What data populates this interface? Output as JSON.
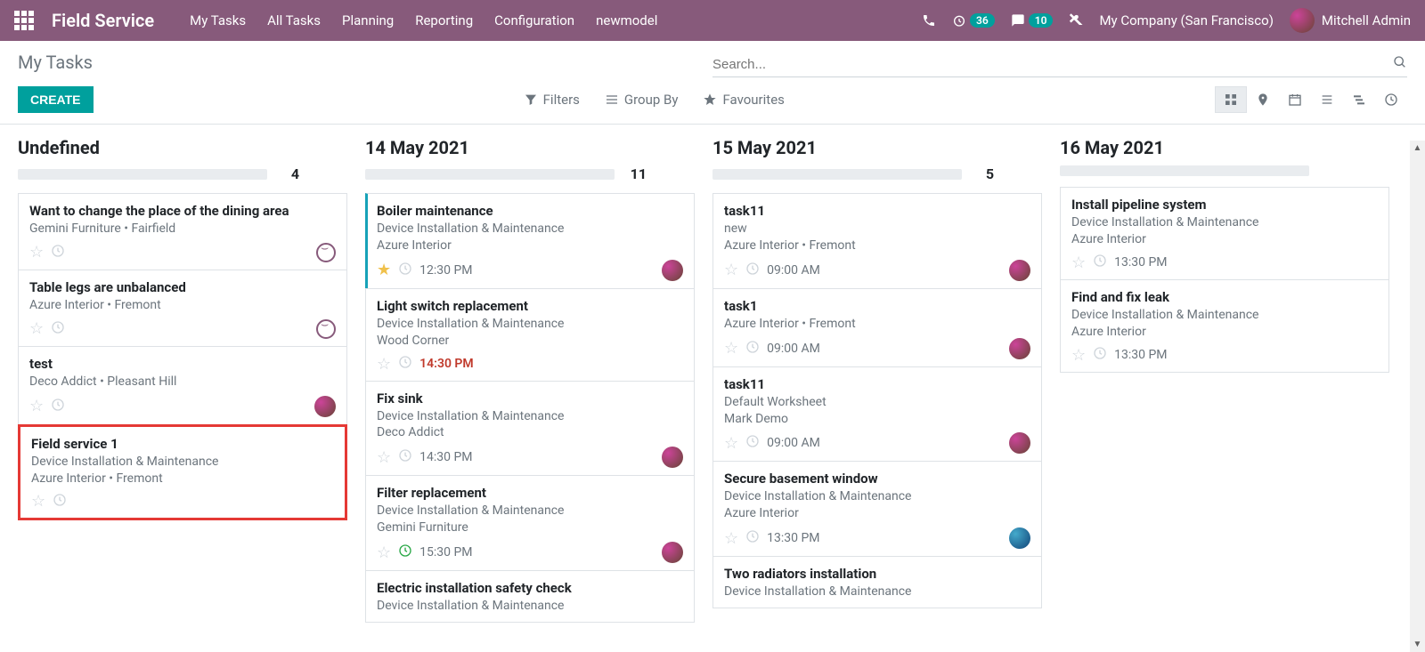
{
  "navbar": {
    "brand": "Field Service",
    "links": [
      "My Tasks",
      "All Tasks",
      "Planning",
      "Reporting",
      "Configuration",
      "newmodel"
    ],
    "badge1": "36",
    "badge2": "10",
    "company": "My Company (San Francisco)",
    "user": "Mitchell Admin"
  },
  "control": {
    "title": "My Tasks",
    "create": "CREATE",
    "search_placeholder": "Search...",
    "filters": "Filters",
    "groupby": "Group By",
    "favourites": "Favourites"
  },
  "columns": [
    {
      "title": "Undefined",
      "count": "4",
      "cards": [
        {
          "title": "Want to change the place of the dining area",
          "line1": "Gemini Furniture • Fairfield",
          "star": false,
          "clock": false,
          "smiley": true
        },
        {
          "title": "Table legs are unbalanced",
          "line1": "Azure Interior • Fremont",
          "star": false,
          "clock": false,
          "smiley": true
        },
        {
          "title": "test",
          "line1": "Deco Addict • Pleasant Hill",
          "star": false,
          "clock": false,
          "avatar": true
        },
        {
          "title": "Field service 1",
          "line1": "Device Installation & Maintenance",
          "line2": "Azure Interior • Fremont",
          "star": false,
          "clock": false,
          "highlight": true
        }
      ]
    },
    {
      "title": "14 May 2021",
      "count": "11",
      "cards": [
        {
          "title": "Boiler maintenance",
          "line1": "Device Installation & Maintenance",
          "line2": "Azure Interior",
          "star": true,
          "clock": false,
          "time": "12:30 PM",
          "avatar": true,
          "accent": true
        },
        {
          "title": "Light switch replacement",
          "line1": "Device Installation & Maintenance",
          "line2": "Wood Corner",
          "star": false,
          "clock": false,
          "time": "14:30 PM",
          "overdue": true
        },
        {
          "title": "Fix sink",
          "line1": "Device Installation & Maintenance",
          "line2": "Deco Addict",
          "star": false,
          "clock": false,
          "time": "14:30 PM",
          "avatar": true
        },
        {
          "title": "Filter replacement",
          "line1": "Device Installation & Maintenance",
          "line2": "Gemini Furniture",
          "star": false,
          "clockGreen": true,
          "time": "15:30 PM",
          "avatar": true
        },
        {
          "title": "Electric installation safety check",
          "line1": "Device Installation & Maintenance"
        }
      ]
    },
    {
      "title": "15 May 2021",
      "count": "5",
      "cards": [
        {
          "title": "task11",
          "line1": "new",
          "line2": "Azure Interior • Fremont",
          "star": false,
          "clock": false,
          "time": "09:00 AM",
          "avatar": true
        },
        {
          "title": "task1",
          "line1": "Azure Interior • Fremont",
          "star": false,
          "clock": false,
          "time": "09:00 AM",
          "avatar": true
        },
        {
          "title": "task11",
          "line1": "Default Worksheet",
          "line2": "Mark Demo",
          "star": false,
          "clock": false,
          "time": "09:00 AM",
          "avatar": true
        },
        {
          "title": "Secure basement window",
          "line1": "Device Installation & Maintenance",
          "line2": "Azure Interior",
          "star": false,
          "clock": false,
          "time": "13:30 PM",
          "avatarBlue": true
        },
        {
          "title": "Two radiators installation",
          "line1": "Device Installation & Maintenance"
        }
      ]
    },
    {
      "title": "16 May 2021",
      "count": "",
      "cards": [
        {
          "title": "Install pipeline system",
          "line1": "Device Installation & Maintenance",
          "line2": "Azure Interior",
          "star": false,
          "clock": false,
          "time": "13:30 PM"
        },
        {
          "title": "Find and fix leak",
          "line1": "Device Installation & Maintenance",
          "line2": "Azure Interior",
          "star": false,
          "clock": false,
          "time": "13:30 PM"
        }
      ]
    }
  ]
}
